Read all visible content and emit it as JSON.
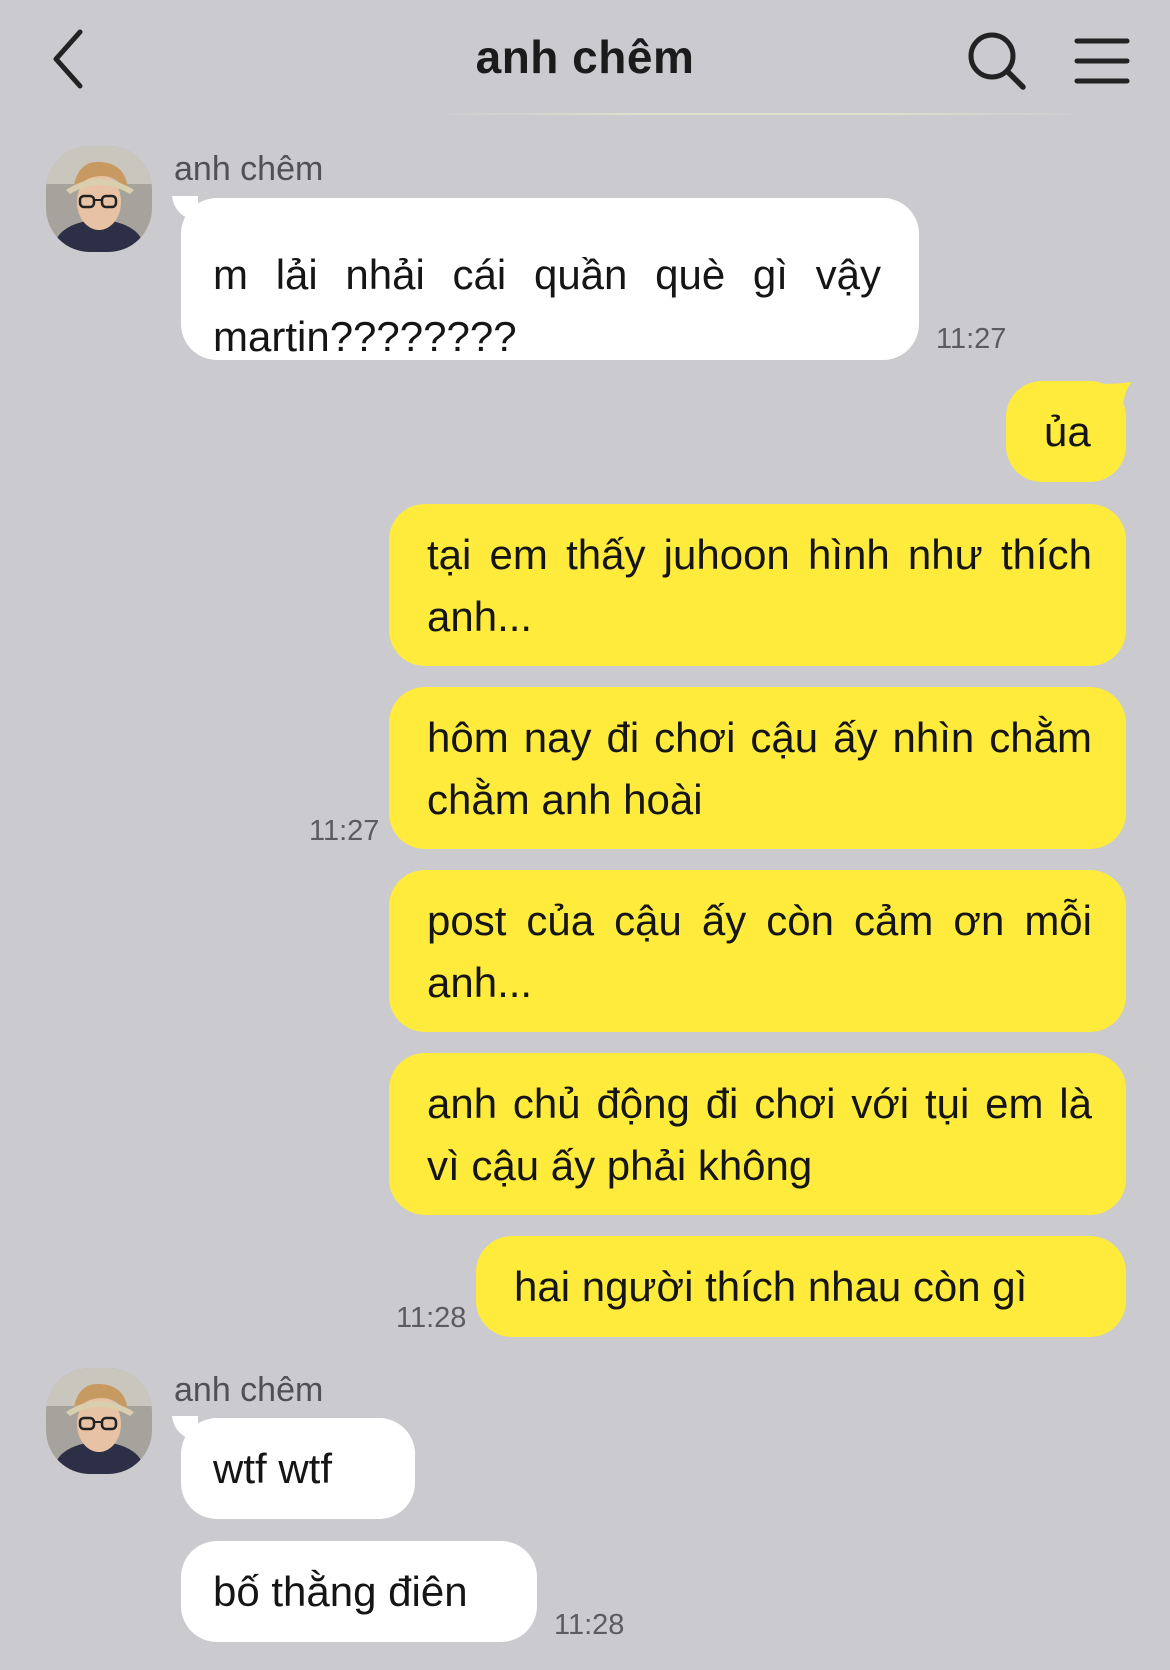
{
  "header": {
    "title": "anh chêm",
    "back_icon": "chevron-left-icon",
    "search_icon": "search-icon",
    "menu_icon": "hamburger-menu-icon"
  },
  "colors": {
    "background": "#cbcbcf",
    "incoming_bubble": "#ffffff",
    "outgoing_bubble": "#ffeb3b"
  },
  "messages": {
    "group1": {
      "sender": "anh chêm",
      "bubbles": [
        "m lải nhải cái quần què gì vậy martin????????"
      ],
      "time": "11:27"
    },
    "group2": {
      "bubbles": [
        "ủa",
        "tại em thấy juhoon hình như thích anh...",
        "hôm nay đi chơi cậu ấy nhìn chằm chằm anh hoài",
        "post của cậu ấy còn cảm ơn mỗi anh..."
      ],
      "time": "11:27"
    },
    "group3": {
      "bubbles": [
        "anh chủ động đi chơi với tụi em là vì cậu ấy phải không",
        "hai người thích nhau còn gì"
      ],
      "time": "11:28"
    },
    "group4": {
      "sender": "anh chêm",
      "bubbles": [
        "wtf wtf",
        "bố thằng điên"
      ],
      "time": "11:28"
    }
  }
}
